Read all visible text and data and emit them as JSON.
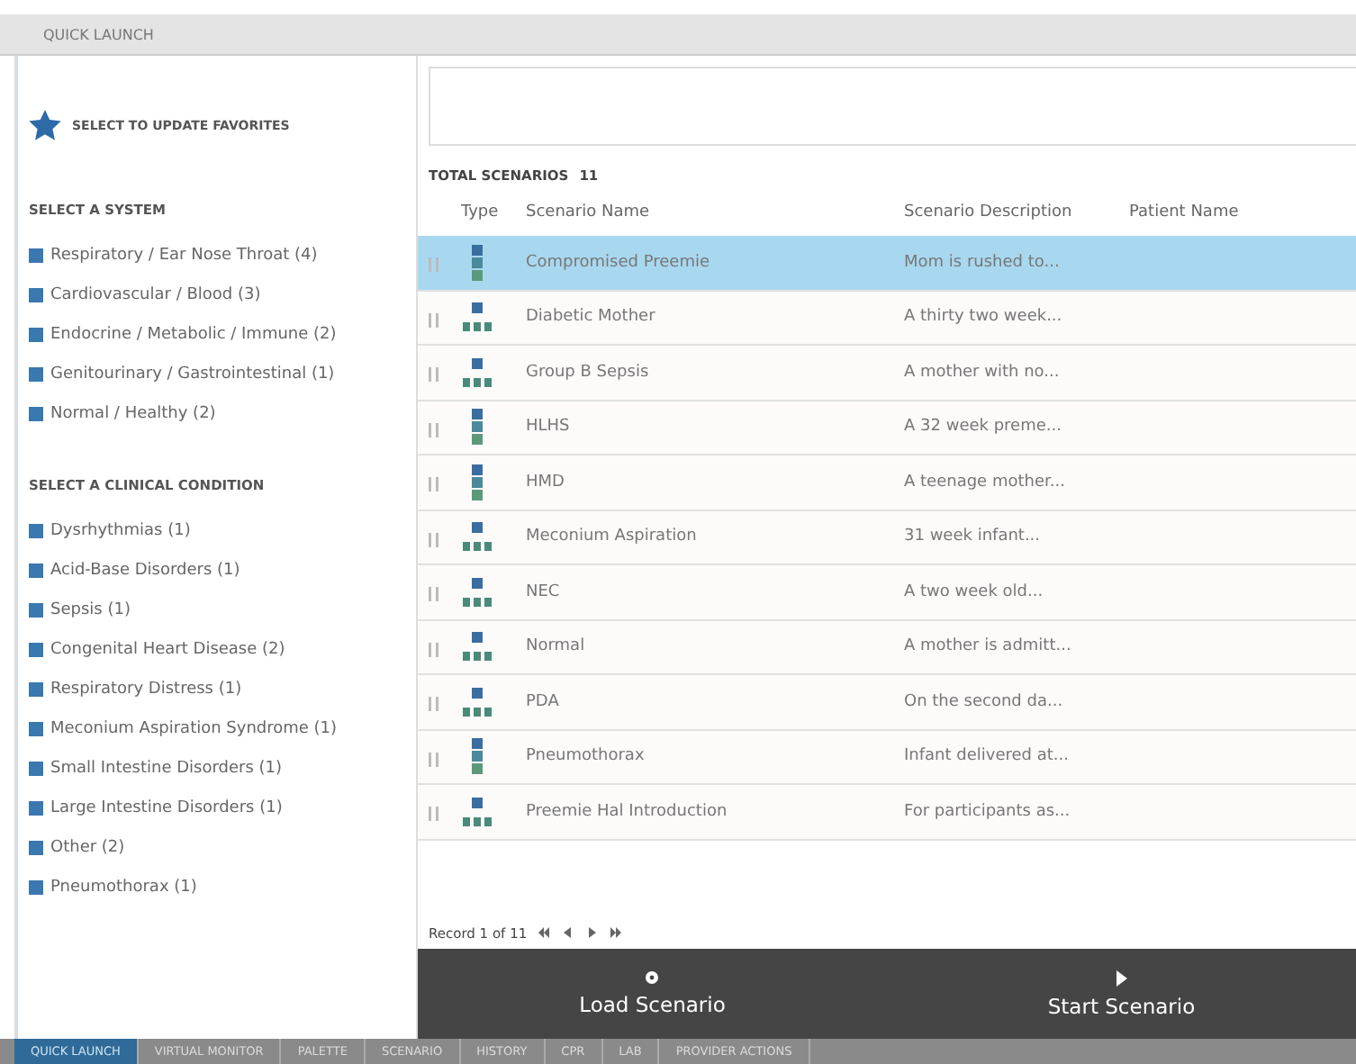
{
  "window": {
    "title": "QUICK LAUNCH"
  },
  "favorites": {
    "label": "SELECT TO UPDATE FAVORITES"
  },
  "systems": {
    "heading": "SELECT A SYSTEM",
    "items": [
      {
        "label": "Respiratory / Ear Nose Throat (4)"
      },
      {
        "label": "Cardiovascular / Blood (3)"
      },
      {
        "label": "Endocrine / Metabolic / Immune (2)"
      },
      {
        "label": "Genitourinary / Gastrointestinal (1)"
      },
      {
        "label": "Normal / Healthy (2)"
      }
    ]
  },
  "conditions": {
    "heading": "SELECT A CLINICAL CONDITION",
    "items": [
      {
        "label": "Dysrhythmias (1)"
      },
      {
        "label": "Acid-Base Disorders (1)"
      },
      {
        "label": "Sepsis (1)"
      },
      {
        "label": "Congenital Heart Disease (2)"
      },
      {
        "label": "Respiratory Distress (1)"
      },
      {
        "label": "Meconium Aspiration Syndrome (1)"
      },
      {
        "label": "Small Intestine Disorders (1)"
      },
      {
        "label": "Large Intestine Disorders (1)"
      },
      {
        "label": "Other (2)"
      },
      {
        "label": "Pneumothorax (1)"
      }
    ]
  },
  "table": {
    "total_label": "TOTAL SCENARIOS",
    "total": "11",
    "columns": [
      "Type",
      "Scenario Name",
      "Scenario Description",
      "Patient Name"
    ],
    "rows": [
      {
        "kind": "single",
        "name": "Compromised Preemie",
        "description": "Mom is rushed to...",
        "selected": true
      },
      {
        "kind": "family",
        "name": "Diabetic Mother",
        "description": "A thirty two week...",
        "selected": false
      },
      {
        "kind": "family",
        "name": "Group B Sepsis",
        "description": "A mother with no...",
        "selected": false
      },
      {
        "kind": "single",
        "name": "HLHS",
        "description": "A 32 week preme...",
        "selected": false
      },
      {
        "kind": "single",
        "name": "HMD",
        "description": "A teenage mother...",
        "selected": false
      },
      {
        "kind": "family",
        "name": "Meconium Aspiration",
        "description": "31 week infant...",
        "selected": false
      },
      {
        "kind": "family",
        "name": "NEC",
        "description": "A two week old...",
        "selected": false
      },
      {
        "kind": "family",
        "name": "Normal",
        "description": "A mother is admitt...",
        "selected": false
      },
      {
        "kind": "family",
        "name": "PDA",
        "description": "On the second da...",
        "selected": false
      },
      {
        "kind": "single",
        "name": "Pneumothorax",
        "description": "Infant delivered at...",
        "selected": false
      },
      {
        "kind": "family",
        "name": "Preemie Hal Introduction",
        "description": "For participants as...",
        "selected": false
      }
    ],
    "pager": "Record 1 of 11"
  },
  "actions": [
    {
      "kind": "load",
      "label": "Load Scenario"
    },
    {
      "kind": "start",
      "label": "Start Scenario"
    }
  ],
  "bottom_tabs": [
    {
      "label": "QUICK LAUNCH",
      "selected": true
    },
    {
      "label": "VIRTUAL MONITOR",
      "selected": false
    },
    {
      "label": "PALETTE",
      "selected": false
    },
    {
      "label": "SCENARIO",
      "selected": false
    },
    {
      "label": "HISTORY",
      "selected": false
    },
    {
      "label": "CPR",
      "selected": false
    },
    {
      "label": "LAB",
      "selected": false
    },
    {
      "label": "PROVIDER ACTIONS",
      "selected": false
    }
  ]
}
